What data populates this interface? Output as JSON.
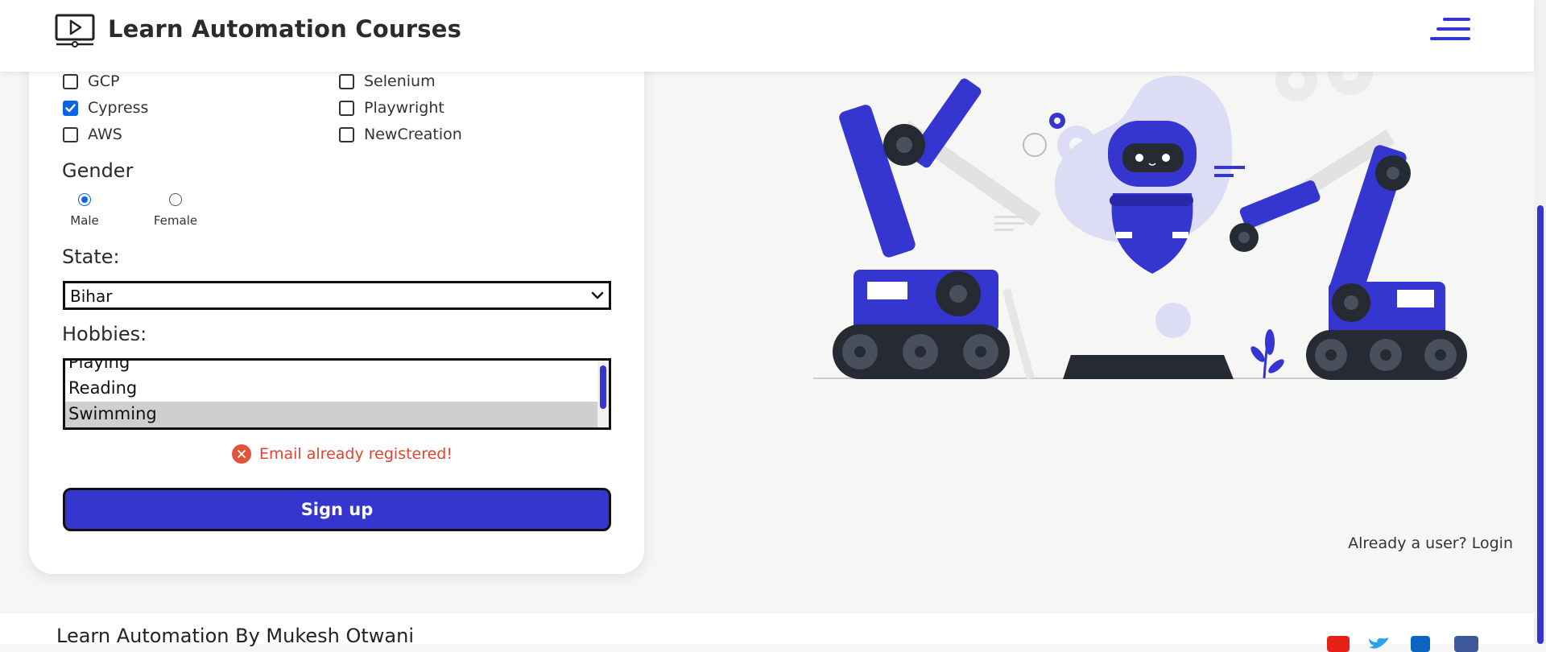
{
  "header": {
    "brand": "Learn Automation Courses",
    "logo_icon": "video-player-icon",
    "menu_icon": "hamburger-menu-icon"
  },
  "form": {
    "courses": [
      {
        "label": "GCP",
        "checked": false
      },
      {
        "label": "Cypress",
        "checked": true
      },
      {
        "label": "AWS",
        "checked": false
      },
      {
        "label": "Selenium",
        "checked": false
      },
      {
        "label": "Playwright",
        "checked": false
      },
      {
        "label": "NewCreation",
        "checked": false
      }
    ],
    "gender_label": "Gender",
    "gender_options": [
      {
        "label": "Male",
        "selected": true
      },
      {
        "label": "Female",
        "selected": false
      }
    ],
    "state_label": "State:",
    "state_value": "Bihar",
    "hobbies_label": "Hobbies:",
    "hobbies_options": [
      {
        "label": "Playing",
        "selected": false
      },
      {
        "label": "Reading",
        "selected": false
      },
      {
        "label": "Swimming",
        "selected": true
      }
    ],
    "error_message": "Email already registered!",
    "signup_label": "Sign up",
    "already_user_text": "Already a user?",
    "login_label": "Login"
  },
  "footer": {
    "title": "Learn Automation By Mukesh Otwani",
    "social_icons": [
      "youtube-icon",
      "twitter-icon",
      "linkedin-icon",
      "facebook-icon"
    ]
  },
  "colors": {
    "accent": "#3535cf",
    "checkbox_checked": "#0b63e5",
    "error": "#e0442c"
  }
}
